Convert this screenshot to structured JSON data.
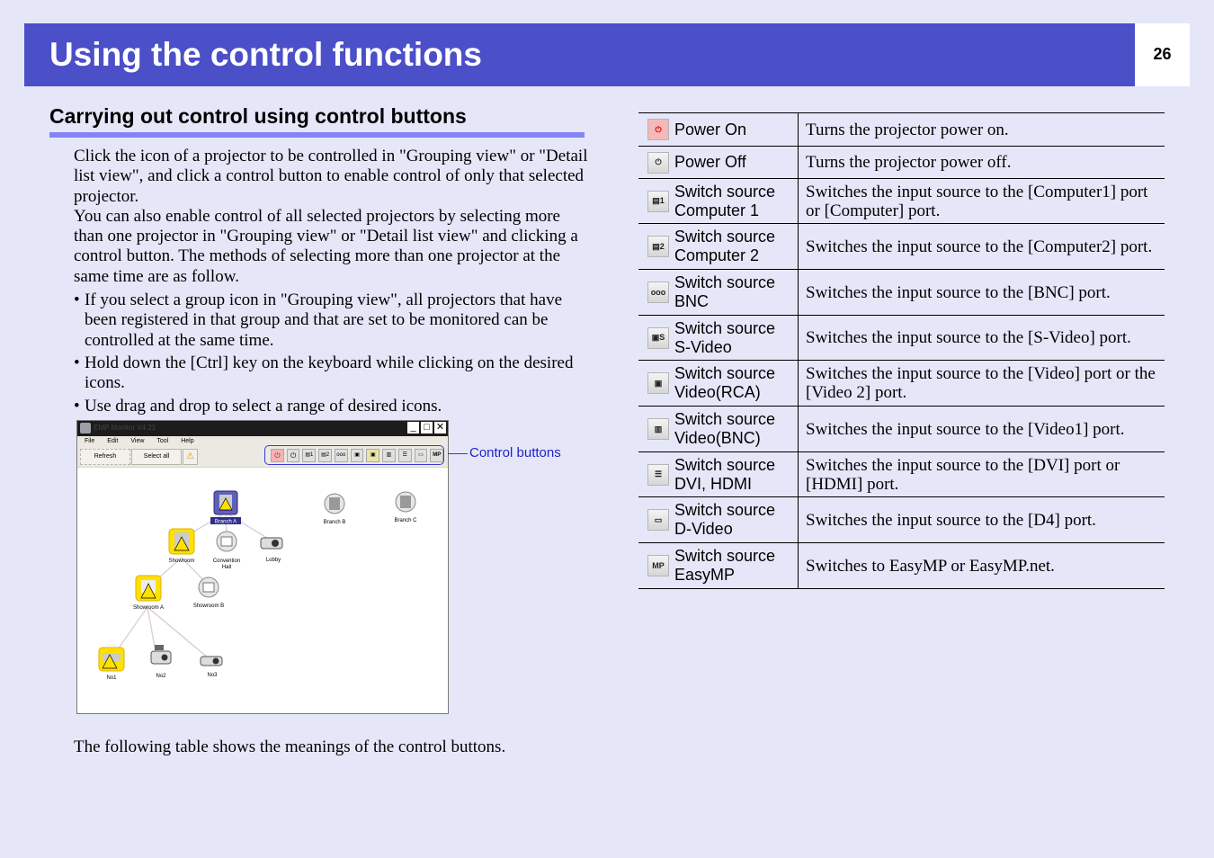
{
  "header": {
    "title": "Using the control functions",
    "page_number": "26"
  },
  "section": {
    "title": "Carrying out control using control buttons",
    "paragraph1": "Click the icon of a projector to be controlled in \"Grouping view\" or \"Detail list view\", and click a control button to enable control of only that selected projector.",
    "paragraph2": "You can also enable control of all selected projectors by selecting more than one projector in \"Grouping view\" or \"Detail list view\" and clicking a control button. The methods of selecting more than one projector at the same time are as follow.",
    "bullets": [
      "If you select a group icon in \"Grouping view\", all projectors that have been registered in that group and that are set to be monitored can be controlled at the same time.",
      "Hold down the [Ctrl] key on the keyboard while clicking on the desired icons.",
      "Use drag and drop to select a range of desired icons."
    ],
    "footer": "The following table shows the meanings of the control buttons."
  },
  "screenshot": {
    "callout": "Control buttons",
    "window_title": "EMP Monitor V4.21",
    "menu": [
      "File",
      "Edit",
      "View",
      "Tool",
      "Help"
    ],
    "toolbar": {
      "refresh": "Refresh",
      "select_all": "Select all"
    },
    "control_icons": [
      "power-on",
      "power-off",
      "computer1",
      "computer2",
      "bnc",
      "s-video",
      "video-rca",
      "video-bnc",
      "dvi-hdmi",
      "d-video",
      "easymp"
    ],
    "nodes": {
      "branch_a": "Branch A",
      "branch_b": "Branch B",
      "branch_c": "Branch C",
      "showroom": "Showroom",
      "convention_hall_1": "Convention",
      "convention_hall_2": "Hall",
      "lobby": "Lobby",
      "showroom_a": "Showroom A",
      "showroom_b": "Showroom B",
      "no1": "No1",
      "no2": "No2",
      "no3": "No3"
    }
  },
  "table": {
    "rows": [
      {
        "icon": "power-on-icon",
        "glyph": "⏻",
        "label1": "Power On",
        "label2": "",
        "desc": "Turns the projector power on."
      },
      {
        "icon": "power-off-icon",
        "glyph": "⏻",
        "label1": "Power Off",
        "label2": "",
        "desc": "Turns the projector power off."
      },
      {
        "icon": "computer1-icon",
        "glyph": "▤1",
        "label1": "Switch source",
        "label2": "Computer 1",
        "desc": "Switches the input source to the [Computer1] port or [Computer] port."
      },
      {
        "icon": "computer2-icon",
        "glyph": "▤2",
        "label1": "Switch source",
        "label2": "Computer 2",
        "desc": "Switches the input source to the [Computer2] port."
      },
      {
        "icon": "bnc-icon",
        "glyph": "ooo",
        "label1": "Switch source",
        "label2": "BNC",
        "desc": "Switches the input source to the [BNC] port."
      },
      {
        "icon": "s-video-icon",
        "glyph": "▣S",
        "label1": "Switch source",
        "label2": "S-Video",
        "desc": "Switches the input source to the [S-Video] port."
      },
      {
        "icon": "video-rca-icon",
        "glyph": "▣",
        "label1": "Switch source",
        "label2": "Video(RCA)",
        "desc": "Switches the input source to the [Video] port or the [Video 2] port."
      },
      {
        "icon": "video-bnc-icon",
        "glyph": "▥",
        "label1": "Switch source",
        "label2": "Video(BNC)",
        "desc": "Switches the input source to the [Video1] port."
      },
      {
        "icon": "dvi-hdmi-icon",
        "glyph": "☰",
        "label1": "Switch source",
        "label2": "DVI, HDMI",
        "desc": "Switches the input source to the [DVI] port or [HDMI] port."
      },
      {
        "icon": "d-video-icon",
        "glyph": "▭",
        "label1": "Switch source",
        "label2": "D-Video",
        "desc": "Switches the input source to the [D4] port."
      },
      {
        "icon": "easymp-icon",
        "glyph": "MP",
        "label1": "Switch source",
        "label2": "EasyMP",
        "desc": "Switches to EasyMP or EasyMP.net."
      }
    ]
  }
}
